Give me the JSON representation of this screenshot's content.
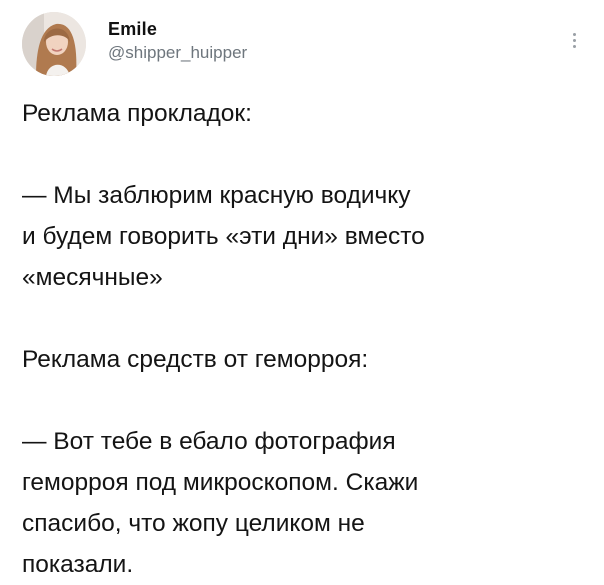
{
  "tweet": {
    "author": {
      "display_name": "Emile",
      "handle": "@shipper_huipper"
    },
    "menu_icon": "more-vertical-icon",
    "paragraphs": [
      "Реклама прокладок:",
      "— Мы заблюрим красную водичку\nи будем говорить «эти дни» вместо\n«месячные»",
      "Реклама средств от геморроя:",
      "— Вот тебе в ебало фотография\nгеморроя под микроскопом. Скажи\nспасибо, что жопу целиком не\nпоказали."
    ]
  },
  "colors": {
    "text": "#141414",
    "handle": "#6e767d",
    "background": "#ffffff"
  }
}
